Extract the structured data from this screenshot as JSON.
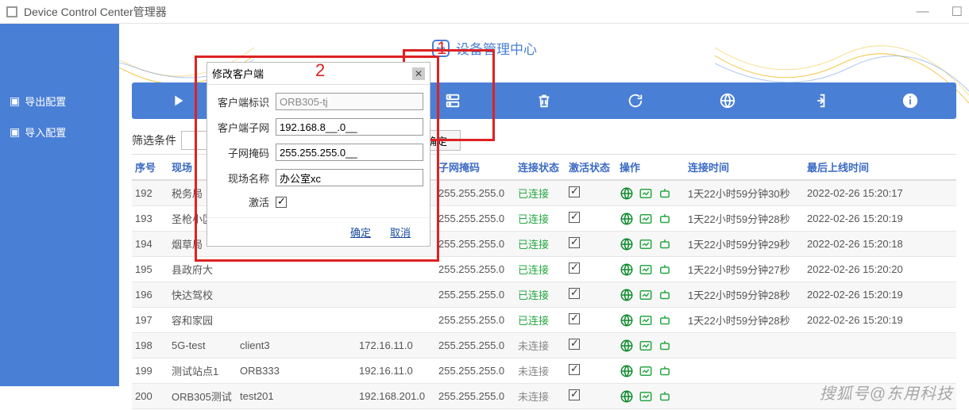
{
  "window": {
    "title": "Device Control Center管理器"
  },
  "brand": {
    "text": "设备管理中心"
  },
  "sidebar": {
    "items": [
      {
        "label": "导出配置"
      },
      {
        "label": "导入配置"
      }
    ]
  },
  "annotations": {
    "one": "1",
    "two": "2"
  },
  "filter": {
    "label": "筛选条件",
    "value": "",
    "confirm": "确定"
  },
  "table": {
    "headers": [
      "序号",
      "现场",
      "",
      "",
      "",
      "子网掩码",
      "连接状态",
      "激活状态",
      "操作",
      "连接时间",
      "最后上线时间"
    ],
    "rows": [
      {
        "seq": "192",
        "site": "税务局",
        "mask": "255.255.255.0",
        "conn": "已连接",
        "connClass": "green",
        "active": true,
        "connTime": "1天22小时59分钟30秒",
        "last": "2022-02-26 15:20:17",
        "c2": "",
        "c3": "",
        "c4": ""
      },
      {
        "seq": "193",
        "site": "圣枪小区",
        "mask": "255.255.255.0",
        "conn": "已连接",
        "connClass": "green",
        "active": true,
        "connTime": "1天22小时59分钟28秒",
        "last": "2022-02-26 15:20:19",
        "c2": "",
        "c3": "",
        "c4": ""
      },
      {
        "seq": "194",
        "site": "烟草局",
        "mask": "255.255.255.0",
        "conn": "已连接",
        "connClass": "green",
        "active": true,
        "connTime": "1天22小时59分钟29秒",
        "last": "2022-02-26 15:20:18",
        "c2": "",
        "c3": "",
        "c4": ""
      },
      {
        "seq": "195",
        "site": "县政府大",
        "mask": "255.255.255.0",
        "conn": "已连接",
        "connClass": "green",
        "active": true,
        "connTime": "1天22小时59分钟27秒",
        "last": "2022-02-26 15:20:20",
        "c2": "",
        "c3": "",
        "c4": ""
      },
      {
        "seq": "196",
        "site": "快达驾校",
        "mask": "255.255.255.0",
        "conn": "已连接",
        "connClass": "green",
        "active": true,
        "connTime": "1天22小时59分钟28秒",
        "last": "2022-02-26 15:20:19",
        "c2": "",
        "c3": "",
        "c4": ""
      },
      {
        "seq": "197",
        "site": "容和家园",
        "mask": "255.255.255.0",
        "conn": "已连接",
        "connClass": "green",
        "active": true,
        "connTime": "1天22小时59分钟28秒",
        "last": "2022-02-26 15:20:19",
        "c2": "",
        "c3": "",
        "c4": ""
      },
      {
        "seq": "198",
        "site": "5G-test",
        "c2": "client3",
        "c3": "",
        "c4": "172.16.11.0",
        "mask": "255.255.255.0",
        "conn": "未连接",
        "connClass": "gray",
        "active": true,
        "connTime": "",
        "last": ""
      },
      {
        "seq": "199",
        "site": "测试站点1",
        "c2": "ORB333",
        "c3": "",
        "c4": "192.16.11.0",
        "mask": "255.255.255.0",
        "conn": "未连接",
        "connClass": "gray",
        "active": true,
        "connTime": "",
        "last": ""
      },
      {
        "seq": "200",
        "site": "ORB305测试",
        "c2": "test201",
        "c3": "",
        "c4": "192.168.201.0",
        "mask": "255.255.255.0",
        "conn": "未连接",
        "connClass": "gray",
        "active": true,
        "connTime": "",
        "last": ""
      }
    ]
  },
  "dialog": {
    "title": "修改客户端",
    "fields": {
      "client_id": {
        "label": "客户端标识",
        "value": "ORB305-tj"
      },
      "client_subnet": {
        "label": "客户端子网",
        "value": "192.168.8__.0__"
      },
      "subnet_mask": {
        "label": "子网掩码",
        "value": "255.255.255.0__"
      },
      "site_name": {
        "label": "现场名称",
        "value": "办公室xc"
      },
      "activate": {
        "label": "激活",
        "checked": true
      }
    },
    "ok": "确定",
    "cancel": "取消"
  },
  "watermark": "搜狐号@东用科技"
}
